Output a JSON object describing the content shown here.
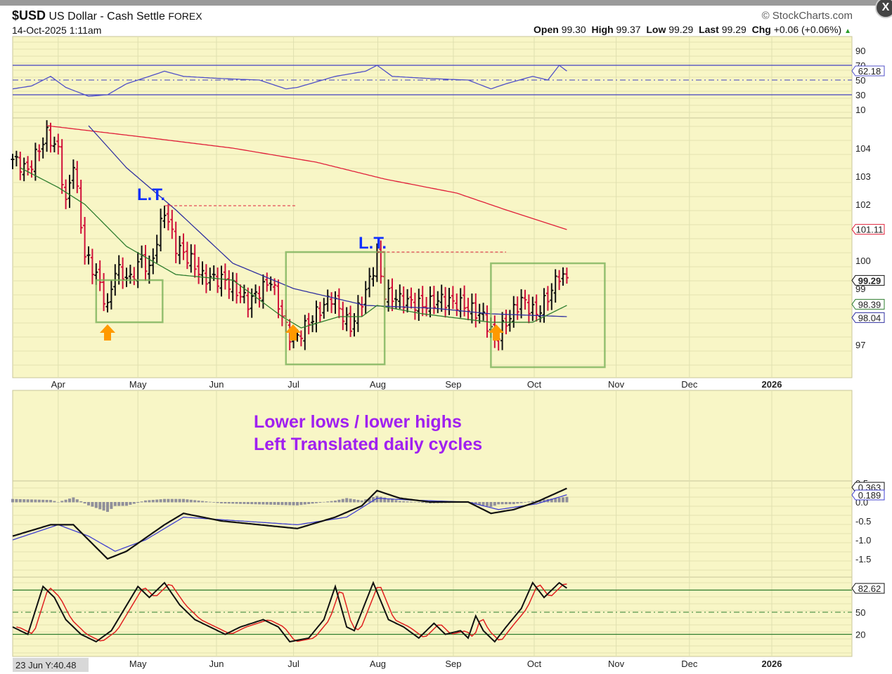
{
  "header": {
    "symbol": "$USD",
    "name": "US Dollar - Cash Settle",
    "exchange": "FOREX",
    "datetime": "14-Oct-2025 1:11am",
    "copyright": "© StockCharts.com",
    "open_label": "Open",
    "open": "99.30",
    "high_label": "High",
    "high": "99.37",
    "low_label": "Low",
    "low": "99.29",
    "last_label": "Last",
    "last": "99.29",
    "chg_label": "Chg",
    "chg": "+0.06 (+0.06%)",
    "close_icon": "X"
  },
  "readout": "23 Jun Y:40.48",
  "annotations": {
    "lt1": "L.T.",
    "lt2": "L.T.",
    "note1": "Lower lows / lower highs",
    "note2": "Left Translated daily cycles"
  },
  "colors": {
    "bg": "#f8f6c6",
    "up": "#111111",
    "down": "#d0103a",
    "ma20": "#2e7d2e",
    "ma50": "#3030a0",
    "ma200": "#e0203a",
    "annot": "#a020f0",
    "box": "#7cb35a",
    "arrow": "#ff9900"
  },
  "chart_data": {
    "type": "ohlc",
    "x_unit": "trading day index (0 = ~20 Mar 2025, 146 = 14 Oct 2025)",
    "month_ticks": [
      {
        "label": "Apr",
        "i": 12
      },
      {
        "label": "May",
        "i": 33
      },
      {
        "label": "Jun",
        "i": 53.7
      },
      {
        "label": "Jul",
        "i": 74
      },
      {
        "label": "Aug",
        "i": 96.2
      },
      {
        "label": "Sep",
        "i": 116.1
      },
      {
        "label": "Oct",
        "i": 137.4
      },
      {
        "label": "Nov",
        "i": 159
      },
      {
        "label": "Dec",
        "i": 178.3
      },
      {
        "label": "2026",
        "i": 200
      }
    ],
    "bottom_ticks": [
      {
        "label": "May",
        "i": 33
      },
      {
        "label": "Jun",
        "i": 53.7
      },
      {
        "label": "Jul",
        "i": 74
      },
      {
        "label": "Aug",
        "i": 96.2
      },
      {
        "label": "Sep",
        "i": 116.1
      },
      {
        "label": "Oct",
        "i": 137.4
      },
      {
        "label": "Nov",
        "i": 159
      },
      {
        "label": "Dec",
        "i": 178.3
      },
      {
        "label": "2026",
        "i": 200
      }
    ],
    "price": {
      "ticks": [
        "104",
        "103",
        "102",
        "100",
        "99",
        "97"
      ],
      "tick_values": [
        104,
        103,
        102,
        100,
        99,
        97
      ],
      "close": [
        [
          0,
          103.6
        ],
        [
          4,
          103.2
        ],
        [
          9,
          104.5
        ],
        [
          12,
          103.9
        ],
        [
          14,
          102.0
        ],
        [
          16,
          103.5
        ],
        [
          19,
          100.2
        ],
        [
          22,
          99.5
        ],
        [
          25,
          98.3
        ],
        [
          27,
          99.7
        ],
        [
          31,
          99.3
        ],
        [
          34,
          100.1
        ],
        [
          36,
          99.6
        ],
        [
          40,
          101.8
        ],
        [
          43,
          100.5
        ],
        [
          47,
          100.0
        ],
        [
          50,
          99.4
        ],
        [
          56,
          99.3
        ],
        [
          62,
          98.5
        ],
        [
          68,
          99.3
        ],
        [
          72,
          97.6
        ],
        [
          74,
          97.1
        ],
        [
          78,
          97.8
        ],
        [
          84,
          98.7
        ],
        [
          89,
          97.6
        ],
        [
          93,
          98.9
        ],
        [
          96,
          100.1
        ],
        [
          98,
          98.8
        ],
        [
          102,
          98.6
        ],
        [
          108,
          98.4
        ],
        [
          113,
          98.6
        ],
        [
          119,
          98.4
        ],
        [
          124,
          98.0
        ],
        [
          127,
          97.2
        ],
        [
          130,
          97.8
        ],
        [
          134,
          98.6
        ],
        [
          138,
          98.1
        ],
        [
          141,
          98.7
        ],
        [
          144,
          99.5
        ],
        [
          146,
          99.3
        ]
      ],
      "ma20": [
        [
          2,
          103.3
        ],
        [
          12,
          102.6
        ],
        [
          19,
          102.0
        ],
        [
          30,
          100.5
        ],
        [
          43,
          99.5
        ],
        [
          58,
          99.3
        ],
        [
          71,
          98.0
        ],
        [
          76,
          97.6
        ],
        [
          86,
          98.0
        ],
        [
          92,
          98.0
        ],
        [
          96,
          98.4
        ],
        [
          108,
          98.1
        ],
        [
          126,
          97.8
        ],
        [
          137,
          97.8
        ],
        [
          146,
          98.4
        ]
      ],
      "ma50": [
        [
          20,
          104.8
        ],
        [
          30,
          103.3
        ],
        [
          43,
          101.8
        ],
        [
          58,
          99.9
        ],
        [
          74,
          99.0
        ],
        [
          93,
          98.4
        ],
        [
          111,
          98.3
        ],
        [
          126,
          98.1
        ],
        [
          146,
          98.0
        ]
      ],
      "ma200": [
        [
          9,
          104.8
        ],
        [
          34,
          104.4
        ],
        [
          58,
          104.0
        ],
        [
          80,
          103.5
        ],
        [
          98,
          102.9
        ],
        [
          117,
          102.4
        ],
        [
          130,
          101.8
        ],
        [
          146,
          101.1
        ]
      ],
      "tags": [
        {
          "text": "101.11",
          "color": "#e0203a",
          "v": 101.11
        },
        {
          "text": "99.29",
          "color": "#111111",
          "v": 99.29,
          "bold": true
        },
        {
          "text": "98.39",
          "color": "#2e7d2e",
          "v": 98.39
        },
        {
          "text": "98.04",
          "color": "#3030a0",
          "v": 98.04
        }
      ]
    },
    "rsi": {
      "ticks": [
        "90",
        "70",
        "50",
        "30",
        "10"
      ],
      "tick_values": [
        90,
        70,
        50,
        30,
        10
      ],
      "last": "62.18",
      "values": [
        [
          0,
          38
        ],
        [
          5,
          42
        ],
        [
          10,
          55
        ],
        [
          14,
          40
        ],
        [
          20,
          28
        ],
        [
          25,
          30
        ],
        [
          30,
          45
        ],
        [
          36,
          55
        ],
        [
          40,
          62
        ],
        [
          45,
          55
        ],
        [
          55,
          52
        ],
        [
          65,
          50
        ],
        [
          72,
          38
        ],
        [
          75,
          40
        ],
        [
          85,
          55
        ],
        [
          93,
          62
        ],
        [
          96,
          70
        ],
        [
          100,
          55
        ],
        [
          110,
          52
        ],
        [
          120,
          50
        ],
        [
          126,
          38
        ],
        [
          130,
          45
        ],
        [
          137,
          55
        ],
        [
          141,
          50
        ],
        [
          144,
          70
        ],
        [
          146,
          62.18
        ]
      ]
    },
    "macd": {
      "ticks": [
        "0.5",
        "0.0",
        "-0.5",
        "-1.0",
        "-1.5"
      ],
      "tick_values": [
        0.5,
        0,
        -0.5,
        -1,
        -1.5
      ],
      "last_macd": "0.363",
      "last_signal": "0.189",
      "macd": [
        [
          0,
          -0.9
        ],
        [
          10,
          -0.6
        ],
        [
          16,
          -0.6
        ],
        [
          20,
          -1.0
        ],
        [
          25,
          -1.5
        ],
        [
          30,
          -1.3
        ],
        [
          40,
          -0.6
        ],
        [
          45,
          -0.3
        ],
        [
          55,
          -0.5
        ],
        [
          65,
          -0.6
        ],
        [
          75,
          -0.7
        ],
        [
          85,
          -0.4
        ],
        [
          92,
          -0.1
        ],
        [
          96,
          0.3
        ],
        [
          102,
          0.1
        ],
        [
          110,
          0.0
        ],
        [
          120,
          0.0
        ],
        [
          126,
          -0.3
        ],
        [
          132,
          -0.2
        ],
        [
          138,
          0.0
        ],
        [
          146,
          0.36
        ]
      ],
      "signal": [
        [
          0,
          -1.0
        ],
        [
          12,
          -0.6
        ],
        [
          20,
          -0.9
        ],
        [
          27,
          -1.3
        ],
        [
          35,
          -1.0
        ],
        [
          45,
          -0.4
        ],
        [
          60,
          -0.5
        ],
        [
          75,
          -0.6
        ],
        [
          88,
          -0.4
        ],
        [
          96,
          0.1
        ],
        [
          105,
          0.05
        ],
        [
          120,
          0.0
        ],
        [
          128,
          -0.2
        ],
        [
          138,
          -0.05
        ],
        [
          146,
          0.19
        ]
      ]
    },
    "stoch": {
      "ticks": [
        "50",
        "20"
      ],
      "tick_values": [
        50,
        20
      ],
      "last": "82.62",
      "k": [
        [
          0,
          30
        ],
        [
          4,
          20
        ],
        [
          8,
          85
        ],
        [
          11,
          70
        ],
        [
          14,
          40
        ],
        [
          18,
          20
        ],
        [
          22,
          10
        ],
        [
          26,
          25
        ],
        [
          33,
          85
        ],
        [
          36,
          70
        ],
        [
          40,
          90
        ],
        [
          44,
          60
        ],
        [
          48,
          40
        ],
        [
          52,
          30
        ],
        [
          56,
          20
        ],
        [
          60,
          30
        ],
        [
          66,
          40
        ],
        [
          70,
          30
        ],
        [
          73,
          10
        ],
        [
          78,
          15
        ],
        [
          82,
          40
        ],
        [
          85,
          85
        ],
        [
          88,
          30
        ],
        [
          90,
          25
        ],
        [
          95,
          90
        ],
        [
          99,
          40
        ],
        [
          103,
          30
        ],
        [
          107,
          15
        ],
        [
          111,
          35
        ],
        [
          114,
          20
        ],
        [
          118,
          25
        ],
        [
          120,
          15
        ],
        [
          122,
          45
        ],
        [
          124,
          25
        ],
        [
          127,
          10
        ],
        [
          130,
          30
        ],
        [
          134,
          55
        ],
        [
          137,
          90
        ],
        [
          140,
          70
        ],
        [
          144,
          90
        ],
        [
          146,
          82.62
        ]
      ]
    }
  }
}
